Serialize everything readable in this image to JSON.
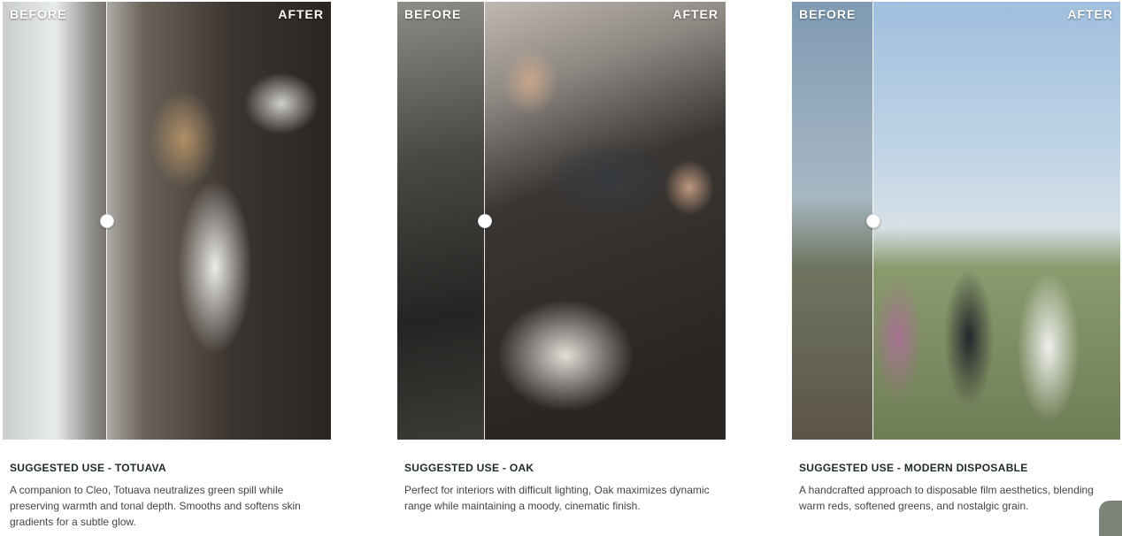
{
  "cards": [
    {
      "before_label": "BEFORE",
      "after_label": "AFTER",
      "split_fraction": 0.315,
      "title": "SUGGESTED USE - TOTUAVA",
      "description": "A companion to Cleo, Totuava neutralizes green spill while preserving warmth and tonal depth. Smooths and softens skin gradients for a subtle glow."
    },
    {
      "before_label": "BEFORE",
      "after_label": "AFTER",
      "split_fraction": 0.265,
      "title": "SUGGESTED USE - OAK",
      "description": "Perfect for interiors with difficult lighting, Oak maximizes dynamic range while maintaining a moody, cinematic finish."
    },
    {
      "before_label": "BEFORE",
      "after_label": "AFTER",
      "split_fraction": 0.245,
      "title": "SUGGESTED USE - MODERN DISPOSABLE",
      "description": "A handcrafted approach to disposable film aesthetics, blending warm reds, softened greens, and nostalgic grain."
    }
  ]
}
